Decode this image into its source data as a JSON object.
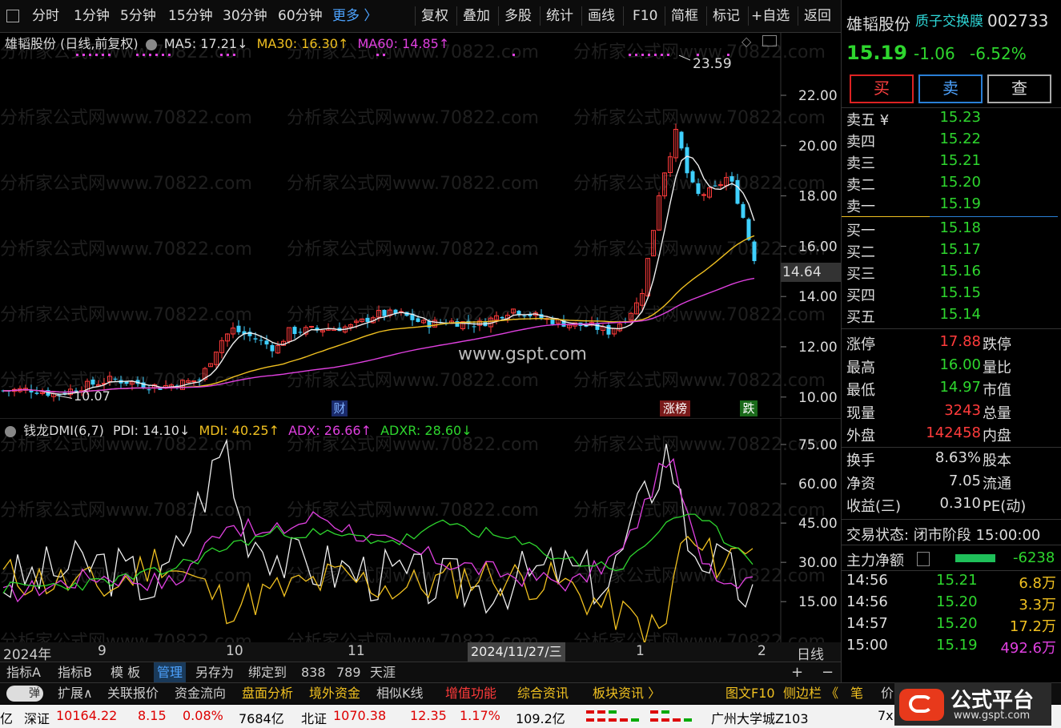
{
  "toolbar": {
    "items": [
      "分时",
      "1分钟",
      "5分钟",
      "15分钟",
      "30分钟",
      "60分钟",
      "更多 〉",
      "复权",
      "叠加",
      "多股",
      "统计",
      "画线",
      "F10",
      "简框",
      "标记",
      "+自选",
      "返回"
    ]
  },
  "main": {
    "title": "雄韬股份 (日线,前复权)",
    "ma5": "MA5: 17.21↓",
    "ma30": "MA30: 16.30↑",
    "ma60": "MA60: 14.85↑",
    "y_ticks": [
      "22.00",
      "20.00",
      "18.00",
      "16.00",
      "14.00",
      "12.00",
      "10.00"
    ],
    "current_price_label": "14.64",
    "high_label": "23.59",
    "low_label": "10.07",
    "markers": {
      "cai": "财",
      "zhangbang": "涨榜",
      "die": "跌"
    },
    "watermark": "分析家公式网www.70822.com",
    "site": "www.gspt.com"
  },
  "sub": {
    "title": "钱龙DMI(6,7)",
    "pdi": "PDI: 14.10↓",
    "mdi": "MDI: 40.25↑",
    "adx": "ADX: 26.66↑",
    "adxr": "ADXR: 28.60↓",
    "y_ticks": [
      "75.00",
      "60.00",
      "45.00",
      "30.00",
      "15.00"
    ]
  },
  "datebar": {
    "year": "2024年",
    "m9": "9",
    "m10": "10",
    "m11": "11",
    "cursor": "2024/11/27/三",
    "m1": "1",
    "m2": "2",
    "period": "日线"
  },
  "bottom1": {
    "items": [
      "指标A",
      "指标B",
      "模 板",
      "管理",
      "另存为",
      "绑定到",
      "838",
      "789",
      "天涯"
    ]
  },
  "bottom2": {
    "toggle": "弹",
    "items": [
      "扩展∧",
      "关联报价",
      "资金流向",
      "盘面分析",
      "境外资金",
      "相似K线",
      "增值功能",
      "综合资讯",
      "板块资讯 〉",
      "图文F10",
      "侧边栏 《",
      "笔",
      "价"
    ]
  },
  "status": {
    "yi": "亿",
    "sz_label": "深证",
    "sz_value": "10164.22",
    "sz_change": "8.15",
    "sz_pct": "0.08%",
    "sz_amount": "7684亿",
    "bz_label": "北证",
    "bz_value": "1070.38",
    "bz_change": "12.35",
    "bz_pct": "1.17%",
    "bz_amount": "109.2亿",
    "location": "广州大学城Z103",
    "extra": "7x"
  },
  "panel": {
    "name": "雄韬股份",
    "concept": "质子交换膜",
    "code": "002733",
    "price": "15.19",
    "change": "-1.06",
    "pct": "-6.52%",
    "buy": "买",
    "sell": "卖",
    "query": "查",
    "asks": [
      {
        "label": "卖五 ¥",
        "price": "15.23"
      },
      {
        "label": "卖四",
        "price": "15.22"
      },
      {
        "label": "卖三",
        "price": "15.21"
      },
      {
        "label": "卖二",
        "price": "15.20"
      },
      {
        "label": "卖一",
        "price": "15.19"
      }
    ],
    "bids": [
      {
        "label": "买一",
        "price": "15.18"
      },
      {
        "label": "买二",
        "price": "15.17"
      },
      {
        "label": "买三",
        "price": "15.16"
      },
      {
        "label": "买四",
        "price": "15.15"
      },
      {
        "label": "买五",
        "price": "15.14"
      }
    ],
    "stats": [
      {
        "l": "涨停",
        "v": "17.88",
        "l2": "跌停"
      },
      {
        "l": "最高",
        "v": "16.00",
        "l2": "量比"
      },
      {
        "l": "最低",
        "v": "14.97",
        "l2": "市值"
      },
      {
        "l": "现量",
        "v": "3243",
        "l2": "总量"
      },
      {
        "l": "外盘",
        "v": "142458",
        "l2": "内盘"
      }
    ],
    "stats2": [
      {
        "l": "换手",
        "v": "8.63%",
        "l2": "股本"
      },
      {
        "l": "净资",
        "v": "7.05",
        "l2": "流通"
      },
      {
        "l": "收益(三)",
        "v": "0.310",
        "l2": "PE(动)"
      }
    ],
    "trade_status": "交易状态: 闭市阶段 15:00:00",
    "main_flow_label": "主力净额",
    "main_flow_value": "-6238",
    "ticks": [
      {
        "t": "14:56",
        "p": "15.21",
        "v": "6.8万"
      },
      {
        "t": "14:56",
        "p": "15.20",
        "v": "3.3万"
      },
      {
        "t": "14:57",
        "p": "15.20",
        "v": "17.2万"
      },
      {
        "t": "15:00",
        "p": "15.19",
        "v": "492.6万"
      }
    ],
    "logo_text": "公式平台",
    "logo_url": "www.gspt.com"
  }
}
